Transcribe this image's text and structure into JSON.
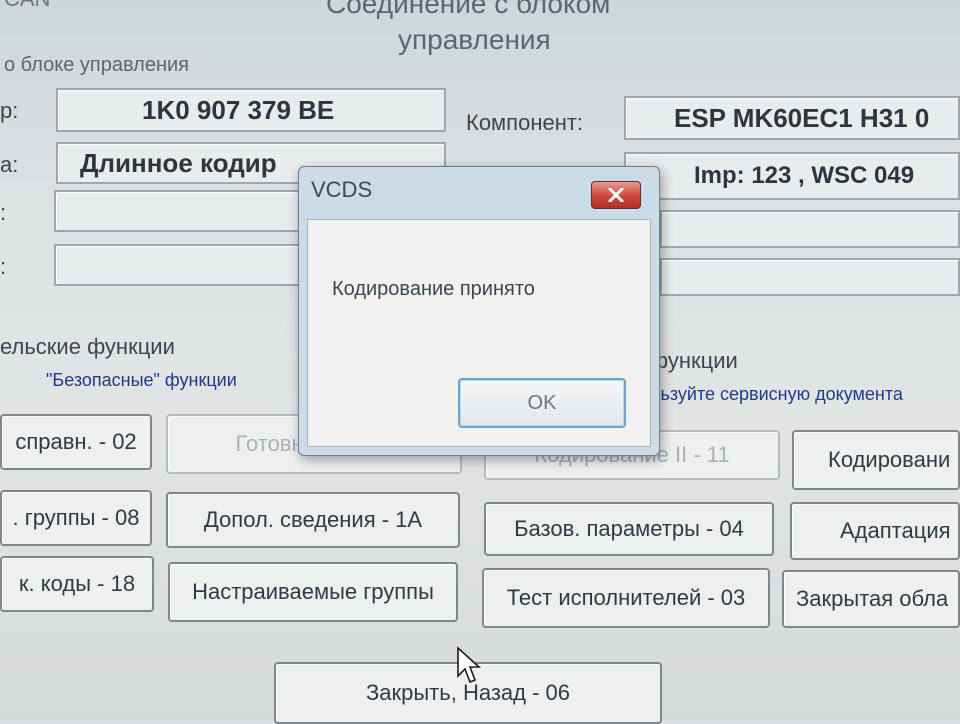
{
  "header": {
    "top_left": "CAN",
    "title_line1": "Соединение с блоком",
    "title_line2": "управления"
  },
  "info_section": {
    "heading": "о блоке управления",
    "part_label": "р:",
    "part_value": "1K0 907 379 BE",
    "coding_label": "а:",
    "coding_value": "Длинное кодир",
    "row3_label": ":",
    "row4_label": ":",
    "component_label": "Компонент:",
    "component_value": "ESP MK60EC1   H31 0",
    "imp_value": "Imp: 123   ,   WSC 049"
  },
  "functions": {
    "basic_heading": "ельские функции",
    "basic_sub": "\"Безопасные\" функции",
    "adv_heading": "функции",
    "adv_sub": "льзуйте сервисную документа"
  },
  "buttons": {
    "b1": "справн. - 02",
    "b2": "Готовность - 15",
    "b3": "Кодирование II - 11",
    "b4": "Кодировани",
    "b5": ". группы - 08",
    "b6": "Допол. сведения - 1А",
    "b7": "Базов. параметры - 04",
    "b8": "Адаптация",
    "b9": "к. коды - 18",
    "b10": "Настраиваемые группы",
    "b11": "Тест исполнителей - 03",
    "b12": "Закрытая обла",
    "close_back": "Закрыть, Назад - 06"
  },
  "dialog": {
    "title": "VCDS",
    "message": "Кодирование принято",
    "ok_label": "OK"
  },
  "colors": {
    "dialog_frame": "#cbdbe7",
    "close_red": "#c9463a",
    "ok_border": "#6fa3c7",
    "link_blue": "#1e3a8c"
  }
}
